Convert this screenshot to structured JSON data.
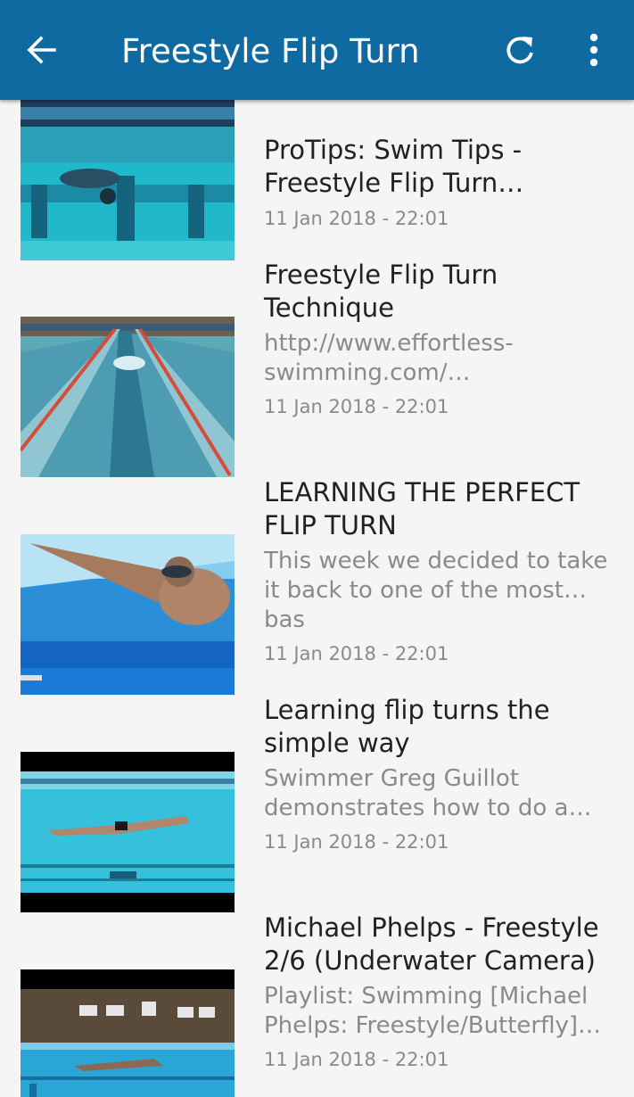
{
  "app_bar": {
    "title": "Freestyle Flip Turn",
    "background": "#0f6aa1",
    "back_icon": "arrow-back-icon",
    "refresh_icon": "refresh-icon",
    "more_icon": "more-vert-icon"
  },
  "videos": [
    {
      "title": "ProTips: Swim Tips -\nFreestyle Flip Turn…",
      "description": "",
      "date": "11 Jan 2018 - 22:01",
      "thumbnail": "underwater-lane-ropes"
    },
    {
      "title": "Freestyle Flip Turn\nTechnique",
      "description": "http://www.effortless-\nswimming.com/…",
      "date": "11 Jan 2018 - 22:01",
      "thumbnail": "pool-lanes-overhead"
    },
    {
      "title": "LEARNING THE PERFECT\nFLIP TURN",
      "description": "This week we decided to take\nit back to one of the most…bas",
      "date": "11 Jan 2018 - 22:01",
      "thumbnail": "swimmer-closeup"
    },
    {
      "title": "Learning flip turns the\nsimple way",
      "description": "Swimmer Greg Guillot\ndemonstrates how to do a…",
      "date": "11 Jan 2018 - 22:01",
      "thumbnail": "underwater-glide"
    },
    {
      "title": "Michael Phelps - Freestyle\n2/6 (Underwater Camera)",
      "description": "Playlist: Swimming [Michael\nPhelps: Freestyle/Butterfly]…",
      "date": "11 Jan 2018 - 22:01",
      "thumbnail": "indoor-pool-underwater"
    }
  ]
}
